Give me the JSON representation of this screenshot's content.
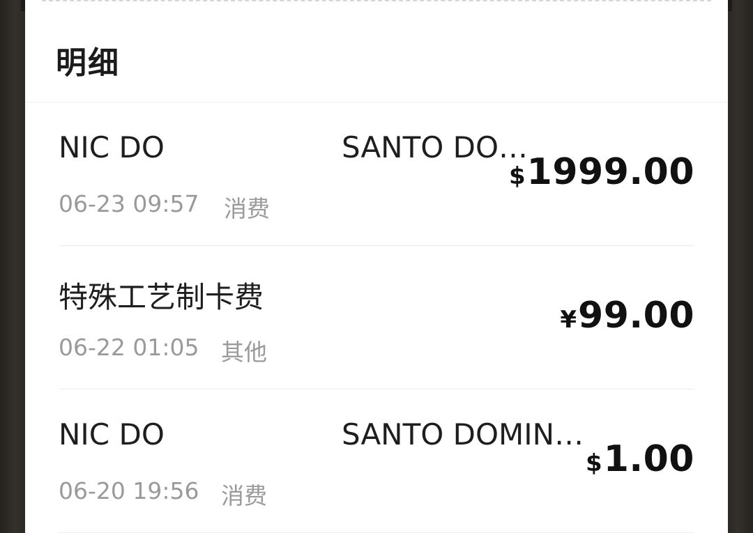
{
  "section": {
    "title": "明细"
  },
  "transactions": [
    {
      "merchant": "NIC DO",
      "location": "SANTO DO…",
      "datetime": "06-23 09:57",
      "type": "消费",
      "currency": "$",
      "amount": "1999.00"
    },
    {
      "merchant": "特殊工艺制卡费",
      "location": "",
      "datetime": "06-22 01:05",
      "type": "其他",
      "currency": "¥",
      "amount": "99.00"
    },
    {
      "merchant": "NIC DO",
      "location": "SANTO DOMIN…",
      "datetime": "06-20 19:56",
      "type": "消费",
      "currency": "$",
      "amount": "1.00"
    }
  ],
  "colors": {
    "background": "#2e2b28",
    "panel": "#ffffff",
    "primary_text": "#1e1e1e",
    "secondary_text": "#9a9a9a"
  }
}
